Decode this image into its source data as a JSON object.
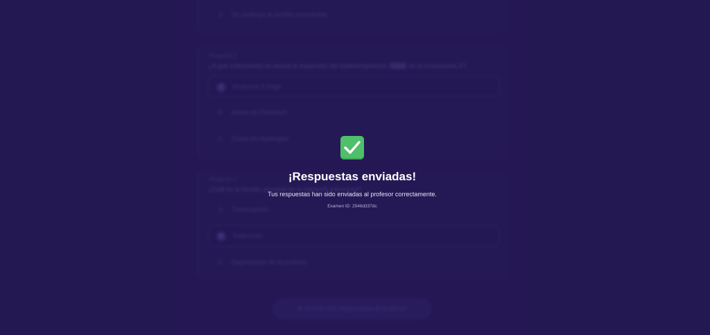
{
  "background": {
    "question_top": {
      "option": {
        "marker": "d",
        "text": "Se sustituye el sentido encontrado"
      }
    },
    "question_2": {
      "label": "Pregunta 2",
      "text_before": "¿A qué enfermedad se asocia la expansión del triplete/repetición",
      "text_highlight": "CGG",
      "text_after": "en el cromosoma X?",
      "options": [
        {
          "marker": "A",
          "text": "Síndrome X frágil",
          "selected": true
        },
        {
          "marker": "B",
          "text": "Ataxia de Friedreich",
          "selected": false
        },
        {
          "marker": "C",
          "text": "Corea de Huntington",
          "selected": false
        }
      ]
    },
    "question_3": {
      "label": "Pregunta 3",
      "text": "¿Cuál es la función principal de la siguiente estructura?",
      "options": [
        {
          "marker": "A",
          "text": "Transcripción",
          "selected": false
        },
        {
          "marker": "B",
          "text": "Traducción",
          "selected": true
        },
        {
          "marker": "C",
          "text": "Degradación de la proteína",
          "selected": false
        }
      ]
    },
    "submit_button": "➤ Enviar mis respuestas al profesor"
  },
  "modal": {
    "icon": "check-mark-icon",
    "title": "¡Respuestas enviadas!",
    "message": "Tus respuestas han sido enviadas al profesor correctamente.",
    "exam_id": "Examen ID: 2546d337dc"
  },
  "colors": {
    "page_background": "#2a1d5e",
    "check_green": "#4fbf6b",
    "title": "#ffffff"
  }
}
